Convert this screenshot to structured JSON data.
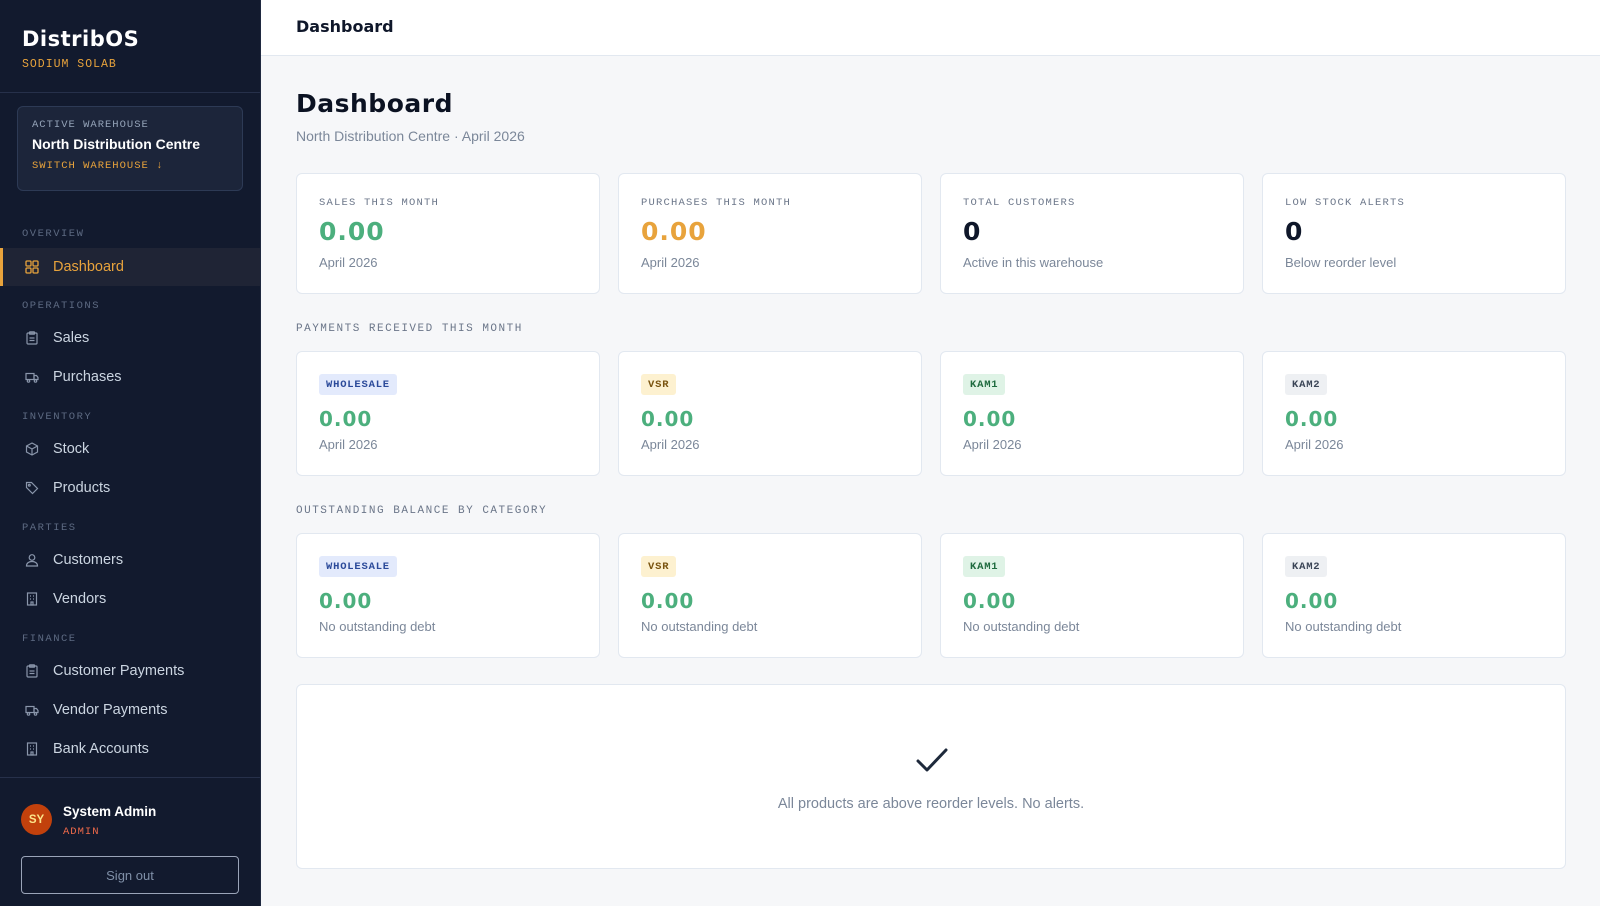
{
  "brand": {
    "name": "DistribOS",
    "subtitle": "SODIUM SOLAB"
  },
  "warehouse": {
    "label": "ACTIVE WAREHOUSE",
    "name": "North Distribution Centre",
    "switch_label": "SWITCH WAREHOUSE ↓"
  },
  "nav": {
    "overview": "OVERVIEW",
    "dashboard": "Dashboard",
    "operations": "OPERATIONS",
    "sales": "Sales",
    "purchases": "Purchases",
    "inventory": "INVENTORY",
    "stock": "Stock",
    "products": "Products",
    "parties": "PARTIES",
    "customers": "Customers",
    "vendors": "Vendors",
    "finance": "FINANCE",
    "customer_payments": "Customer Payments",
    "vendor_payments": "Vendor Payments",
    "bank_accounts": "Bank Accounts"
  },
  "user": {
    "initials": "SY",
    "name": "System Admin",
    "role": "ADMIN",
    "signout": "Sign out"
  },
  "topbar": {
    "title": "Dashboard"
  },
  "page": {
    "title": "Dashboard",
    "subtitle": "North Distribution Centre · April 2026"
  },
  "stats": [
    {
      "label": "SALES THIS MONTH",
      "value": "0.00",
      "note": "April 2026",
      "color": "#4caf7d"
    },
    {
      "label": "PURCHASES THIS MONTH",
      "value": "0.00",
      "note": "April 2026",
      "color": "#e8a33c"
    },
    {
      "label": "TOTAL CUSTOMERS",
      "value": "0",
      "note": "Active in this warehouse",
      "color": "#0f172a"
    },
    {
      "label": "LOW STOCK ALERTS",
      "value": "0",
      "note": "Below reorder level",
      "color": "#0f172a"
    }
  ],
  "payments": {
    "section_label": "PAYMENTS RECEIVED THIS MONTH",
    "cards": [
      {
        "badge": "WHOLESALE",
        "value": "0.00",
        "note": "April 2026"
      },
      {
        "badge": "VSR",
        "value": "0.00",
        "note": "April 2026"
      },
      {
        "badge": "KAM1",
        "value": "0.00",
        "note": "April 2026"
      },
      {
        "badge": "KAM2",
        "value": "0.00",
        "note": "April 2026"
      }
    ]
  },
  "outstanding": {
    "section_label": "OUTSTANDING BALANCE BY CATEGORY",
    "cards": [
      {
        "badge": "WHOLESALE",
        "value": "0.00",
        "note": "No outstanding debt"
      },
      {
        "badge": "VSR",
        "value": "0.00",
        "note": "No outstanding debt"
      },
      {
        "badge": "KAM1",
        "value": "0.00",
        "note": "No outstanding debt"
      },
      {
        "badge": "KAM2",
        "value": "0.00",
        "note": "No outstanding debt"
      }
    ]
  },
  "badge_colors": {
    "WHOLESALE": {
      "bg": "#e3eafc",
      "fg": "#2b4a9a"
    },
    "VSR": {
      "bg": "#fdf1d0",
      "fg": "#7a5410"
    },
    "KAM1": {
      "bg": "#dff3e6",
      "fg": "#1f6b3f"
    },
    "KAM2": {
      "bg": "#eef0f3",
      "fg": "#3b4556"
    }
  },
  "value_color": "#4caf7d",
  "alerts": {
    "empty_text": "All products are above reorder levels. No alerts."
  }
}
